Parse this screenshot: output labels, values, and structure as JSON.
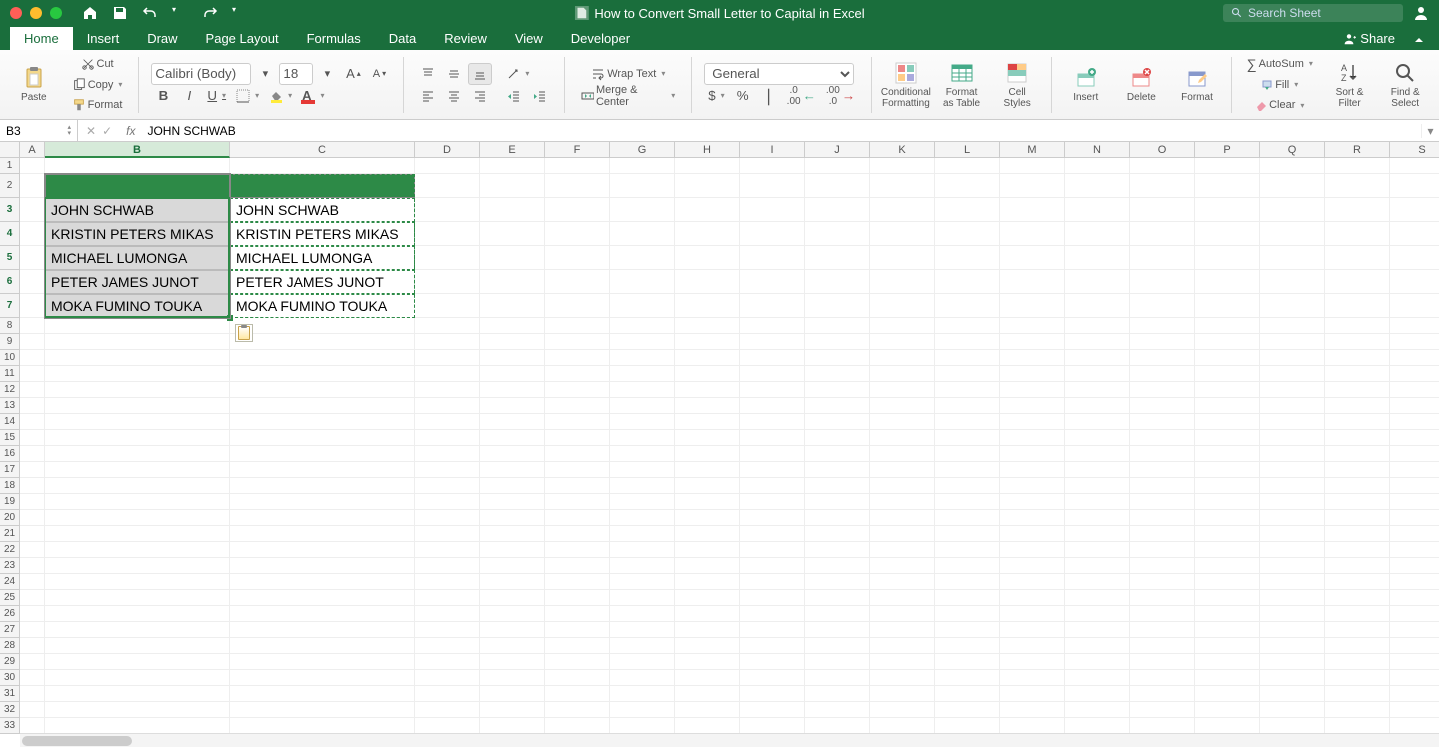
{
  "titlebar": {
    "doc_title": "How to Convert Small Letter to Capital in Excel",
    "search_placeholder": "Search Sheet"
  },
  "tabs": [
    "Home",
    "Insert",
    "Draw",
    "Page Layout",
    "Formulas",
    "Data",
    "Review",
    "View",
    "Developer"
  ],
  "active_tab": "Home",
  "share_label": "Share",
  "clipboard": {
    "paste": "Paste",
    "cut": "Cut",
    "copy": "Copy",
    "format": "Format"
  },
  "font": {
    "name": "Calibri (Body)",
    "size": "18",
    "bold": "B",
    "italic": "I",
    "underline": "U"
  },
  "alignment": {
    "wrap": "Wrap Text",
    "merge": "Merge & Center"
  },
  "number": {
    "format": "General"
  },
  "styles": {
    "conditional": "Conditional\nFormatting",
    "table": "Format\nas Table",
    "cellstyles": "Cell\nStyles"
  },
  "cells_group": {
    "insert": "Insert",
    "delete": "Delete",
    "format": "Format"
  },
  "editing": {
    "autosum": "AutoSum",
    "fill": "Fill",
    "clear": "Clear",
    "sort": "Sort &\nFilter",
    "find": "Find &\nSelect"
  },
  "formula_bar": {
    "cellref": "B3",
    "value": "JOHN SCHWAB"
  },
  "columns": [
    "A",
    "B",
    "C",
    "D",
    "E",
    "F",
    "G",
    "H",
    "I",
    "J",
    "K",
    "L",
    "M",
    "N",
    "O",
    "P",
    "Q",
    "R",
    "S"
  ],
  "col_widths": {
    "A": 25,
    "B": 185,
    "C": 185,
    "default": 65
  },
  "row_count": 33,
  "tall_rows": [
    2,
    3,
    4,
    5,
    6,
    7
  ],
  "selected_rows": [
    3,
    4,
    5,
    6,
    7
  ],
  "selected_col": "B",
  "active_cell": "B3",
  "data_b": [
    "JOHN SCHWAB",
    "KRISTIN PETERS MIKAS",
    "MICHAEL LUMONGA",
    "PETER JAMES JUNOT",
    "MOKA FUMINO TOUKA"
  ],
  "data_c": [
    "JOHN SCHWAB",
    "KRISTIN PETERS MIKAS",
    "MICHAEL LUMONGA",
    "PETER JAMES JUNOT",
    "MOKA FUMINO TOUKA"
  ]
}
